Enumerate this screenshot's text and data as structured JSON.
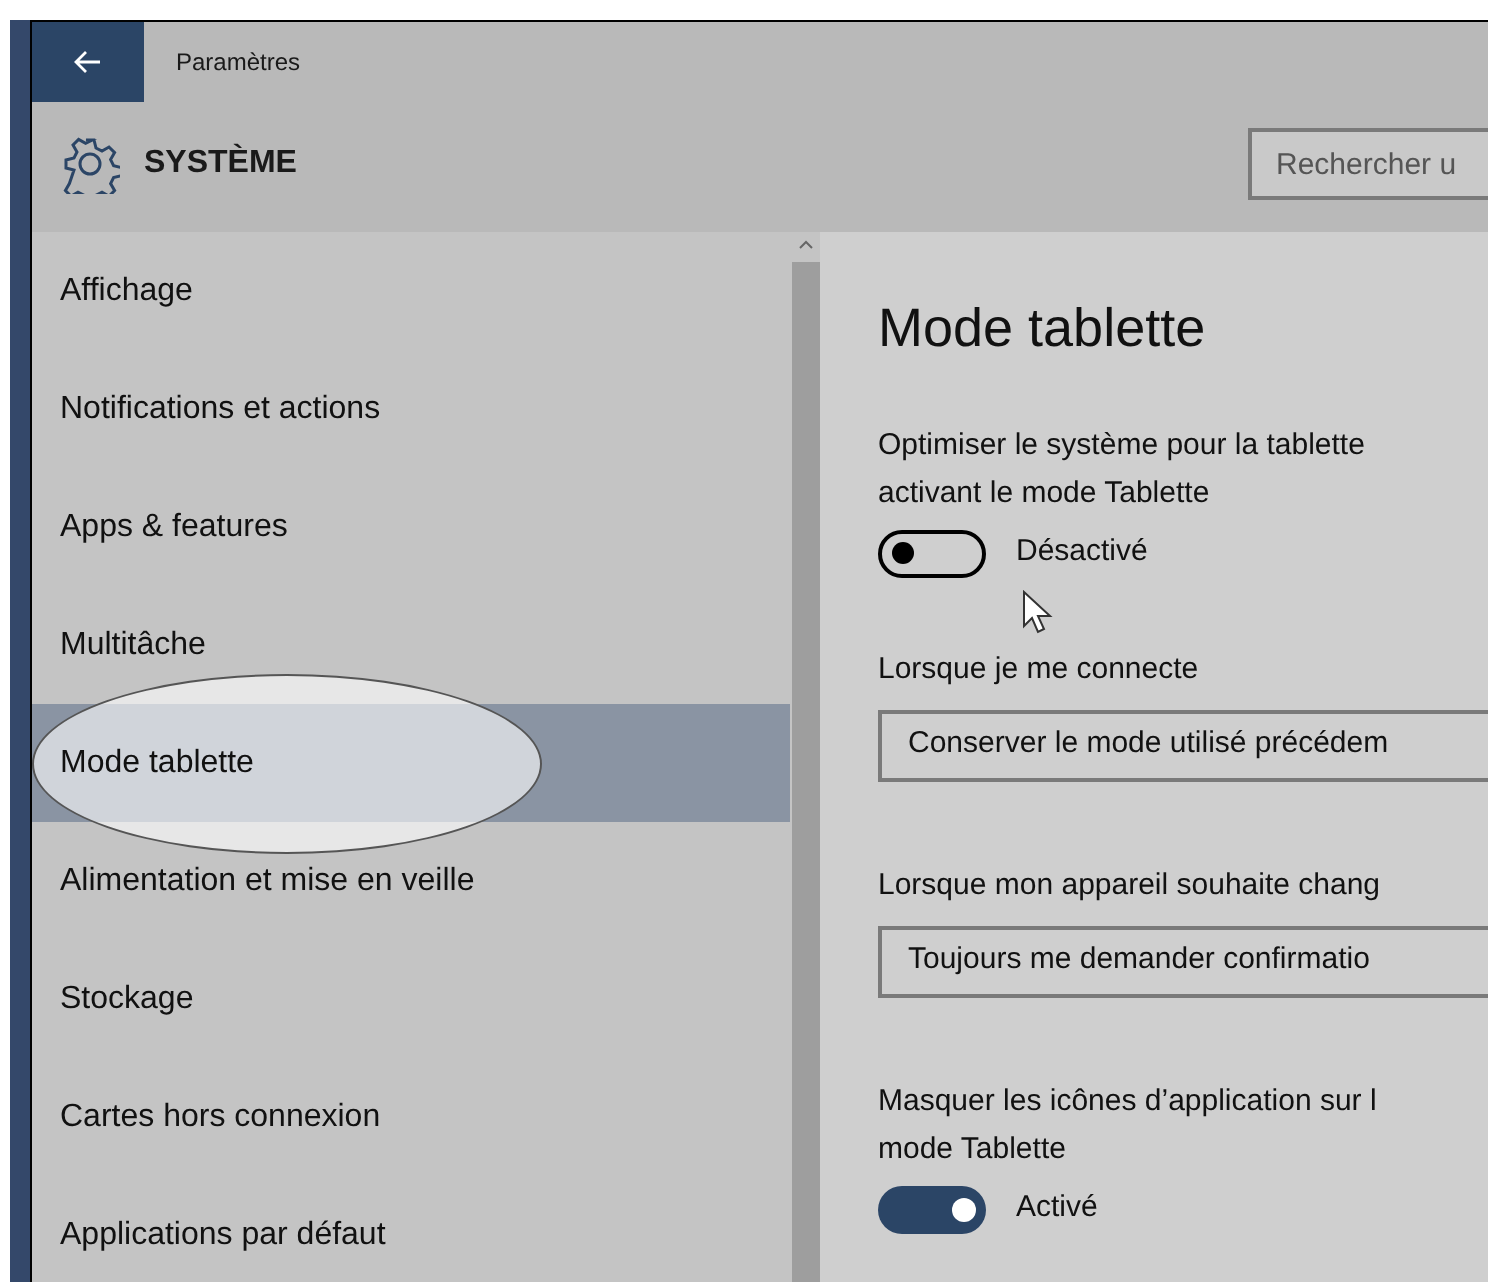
{
  "window": {
    "title": "Paramètres"
  },
  "header": {
    "title": "SYSTÈME",
    "search": {
      "placeholder": "Rechercher u"
    }
  },
  "sidebar": {
    "items": [
      {
        "label": "Affichage",
        "selected": false
      },
      {
        "label": "Notifications et actions",
        "selected": false
      },
      {
        "label": "Apps & features",
        "selected": false
      },
      {
        "label": "Multitâche",
        "selected": false
      },
      {
        "label": "Mode tablette",
        "selected": true
      },
      {
        "label": "Alimentation et mise en veille",
        "selected": false
      },
      {
        "label": "Stockage",
        "selected": false
      },
      {
        "label": "Cartes hors connexion",
        "selected": false
      },
      {
        "label": "Applications par défaut",
        "selected": false
      }
    ]
  },
  "content": {
    "title": "Mode tablette",
    "settings": [
      {
        "kind": "toggle",
        "label": "Optimiser le système pour la tablette",
        "label_line_2": "activant le mode Tablette",
        "on": false,
        "state_text": "Désactivé"
      },
      {
        "kind": "dropdown",
        "label": "Lorsque je me connecte",
        "value": "Conserver le mode utilisé précédem"
      },
      {
        "kind": "dropdown",
        "label": "Lorsque mon appareil souhaite chang",
        "value": "Toujours me demander confirmatio"
      },
      {
        "kind": "toggle",
        "label": "Masquer les icônes d’application sur l",
        "label_line_2": "mode Tablette",
        "on": true,
        "state_text": "Activé"
      }
    ]
  }
}
